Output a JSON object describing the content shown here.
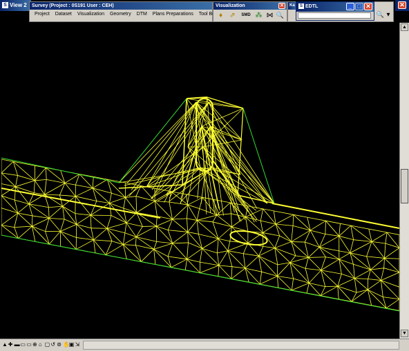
{
  "view_window": {
    "title": "View 2",
    "close_glyph": "✕"
  },
  "survey_toolbar": {
    "title": "Survey (Project : 0S191  User : CEH)",
    "menu": [
      "Project",
      "Dataset",
      "Visualization",
      "Geometry",
      "DTM",
      "Plans Preparations",
      "Tool Boxes"
    ]
  },
  "visualization_toolbar": {
    "title": "Visualization",
    "close_glyph": "✕",
    "tools": [
      {
        "name": "display-points-icon",
        "glyph": "♦"
      },
      {
        "name": "display-lines-icon",
        "glyph": "⇗"
      },
      {
        "name": "display-smd-icon",
        "glyph": "SMD"
      },
      {
        "name": "display-symbols-icon",
        "glyph": "⁂"
      },
      {
        "name": "display-tin-icon",
        "glyph": "⋈"
      },
      {
        "name": "zoom-magnifier-icon",
        "glyph": "🔍"
      }
    ]
  },
  "side_panel": {
    "title": "Ka",
    "zoom_glyph": "🔍",
    "dropdown_glyph": "▾"
  },
  "edtl_window": {
    "title": "EDTL",
    "min_glyph": "_",
    "restore_glyph": "□",
    "close_glyph": "✕",
    "input_value": ""
  },
  "status_toolbar": {
    "tools": [
      "▲",
      "✚",
      "▬",
      "▭",
      "▭",
      "⊕",
      "⌂",
      "▢",
      "↺",
      "⊚",
      "✋",
      "▣",
      "⇲"
    ]
  },
  "scrollbar": {
    "up_glyph": "▲",
    "down_glyph": "▼"
  },
  "colors": {
    "background": "#000000",
    "mesh": "#ffff33",
    "boundary": "#33dd33",
    "titlebar": "#0a246a"
  }
}
